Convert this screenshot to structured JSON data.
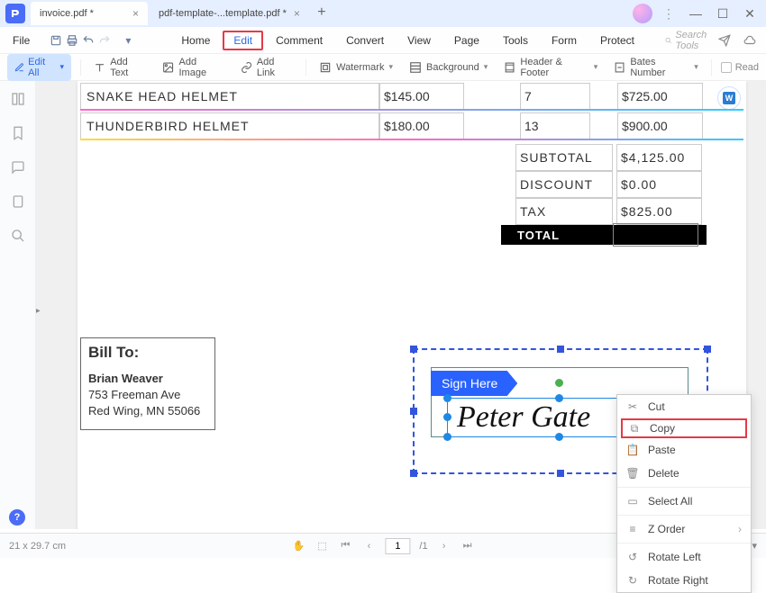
{
  "tabs": [
    {
      "label": "invoice.pdf *",
      "active": true
    },
    {
      "label": "pdf-template-...template.pdf *",
      "active": false
    }
  ],
  "menubar": {
    "file": "File",
    "items": [
      "Home",
      "Edit",
      "Comment",
      "Convert",
      "View",
      "Page",
      "Tools",
      "Form",
      "Protect"
    ],
    "active": "Edit",
    "search_placeholder": "Search Tools"
  },
  "toolbar": {
    "edit_all": "Edit All",
    "add_text": "Add Text",
    "add_image": "Add Image",
    "add_link": "Add Link",
    "watermark": "Watermark",
    "background": "Background",
    "header_footer": "Header & Footer",
    "bates": "Bates Number",
    "read": "Read"
  },
  "invoice": {
    "rows": [
      {
        "name": "SNAKE HEAD HELMET",
        "price": "$145.00",
        "qty": "7",
        "total": "$725.00"
      },
      {
        "name": "THUNDERBIRD HELMET",
        "price": "$180.00",
        "qty": "13",
        "total": "$900.00"
      }
    ],
    "summary": [
      {
        "label": "SUBTOTAL",
        "value": "$4,125.00"
      },
      {
        "label": "DISCOUNT",
        "value": "$0.00"
      },
      {
        "label": "TAX",
        "value": "$825.00"
      }
    ],
    "total_label": "TOTAL"
  },
  "billto": {
    "heading": "Bill To:",
    "name": "Brian Weaver",
    "addr1": "753 Freeman Ave",
    "addr2": "Red Wing, MN 55066"
  },
  "signature": {
    "badge": "Sign Here",
    "text": "Peter Gate"
  },
  "context_menu": {
    "cut": "Cut",
    "copy": "Copy",
    "paste": "Paste",
    "delete": "Delete",
    "select_all": "Select All",
    "zorder": "Z Order",
    "rotate_left": "Rotate Left",
    "rotate_right": "Rotate Right"
  },
  "status": {
    "dims": "21 x 29.7 cm",
    "page_current": "1",
    "page_total": "/1"
  }
}
